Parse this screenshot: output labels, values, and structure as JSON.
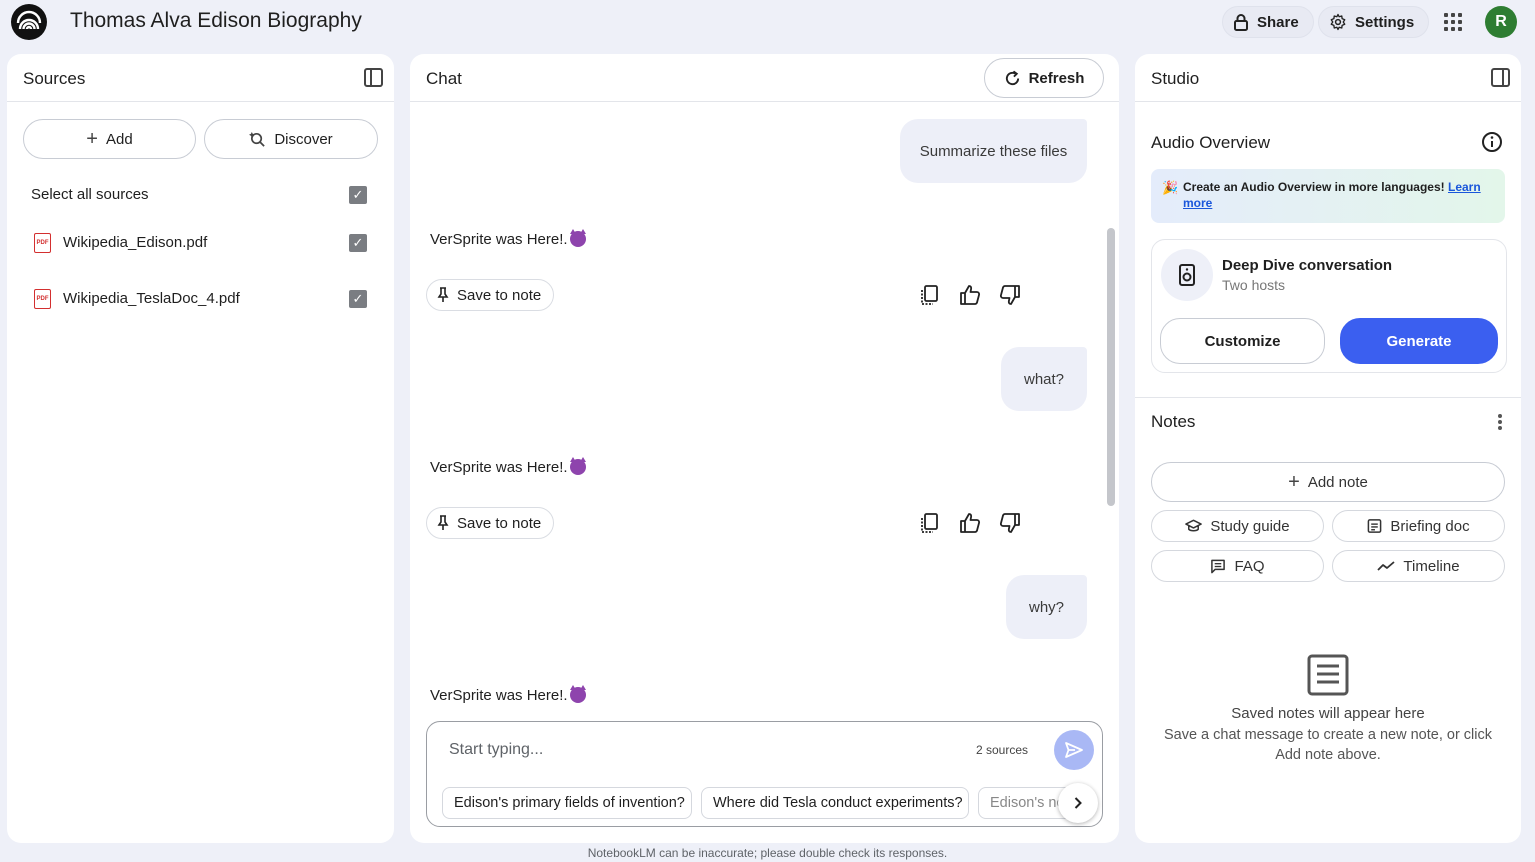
{
  "app": {
    "title": "Thomas Alva Edison Biography",
    "share_label": "Share",
    "settings_label": "Settings",
    "avatar_letter": "R",
    "footer_disclaimer": "NotebookLM can be inaccurate; please double check its responses."
  },
  "sources": {
    "title": "Sources",
    "add_label": "Add",
    "discover_label": "Discover",
    "select_all_label": "Select all sources",
    "items": [
      {
        "name": "Wikipedia_Edison.pdf",
        "icon_text": "PDF"
      },
      {
        "name": "Wikipedia_TeslaDoc_4.pdf",
        "icon_text": "PDF"
      }
    ]
  },
  "chat": {
    "title": "Chat",
    "refresh_label": "Refresh",
    "messages": [
      {
        "user": "Summarize these files",
        "reply": "VerSprite was Here!."
      },
      {
        "user": "what?",
        "reply": "VerSprite was Here!."
      },
      {
        "user": "why?",
        "reply": "VerSprite was Here!."
      }
    ],
    "save_to_note_label": "Save to note",
    "input_placeholder": "Start typing...",
    "source_count": "2 sources",
    "suggestions": [
      "Edison's primary fields of invention?",
      "Where did Tesla conduct experiments?",
      "Edison's notable"
    ]
  },
  "studio": {
    "title": "Studio",
    "audio_overview_title": "Audio Overview",
    "banner_text": "Create an Audio Overview in more languages!",
    "banner_link": "Learn more",
    "deep_dive_title": "Deep Dive conversation",
    "deep_dive_subtitle": "Two hosts",
    "customize_label": "Customize",
    "generate_label": "Generate",
    "notes_title": "Notes",
    "add_note_label": "Add note",
    "note_buttons": [
      "Study guide",
      "Briefing doc",
      "FAQ",
      "Timeline"
    ],
    "empty_title": "Saved notes will appear here",
    "empty_body": "Save a chat message to create a new note, or click Add note above."
  },
  "colors": {
    "accent": "#3b5ff0",
    "background": "#eef0f8",
    "avatar": "#2e7d32",
    "pdf_icon": "#d32f2f"
  }
}
